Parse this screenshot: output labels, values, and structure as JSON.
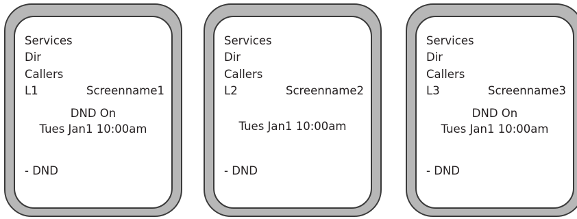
{
  "phones": [
    {
      "menu": [
        "Services",
        "Dir",
        "Callers"
      ],
      "line": "L1",
      "screenname": "Screenname1",
      "dnd_status": "DND On",
      "datetime": "Tues Jan1 10:00am",
      "softkey": "- DND"
    },
    {
      "menu": [
        "Services",
        "Dir",
        "Callers"
      ],
      "line": "L2",
      "screenname": "Screenname2",
      "dnd_status": "",
      "datetime": "Tues Jan1 10:00am",
      "softkey": "- DND"
    },
    {
      "menu": [
        "Services",
        "Dir",
        "Callers"
      ],
      "line": "L3",
      "screenname": "Screenname3",
      "dnd_status": "DND On",
      "datetime": "Tues Jan1 10:00am",
      "softkey": "- DND"
    }
  ]
}
